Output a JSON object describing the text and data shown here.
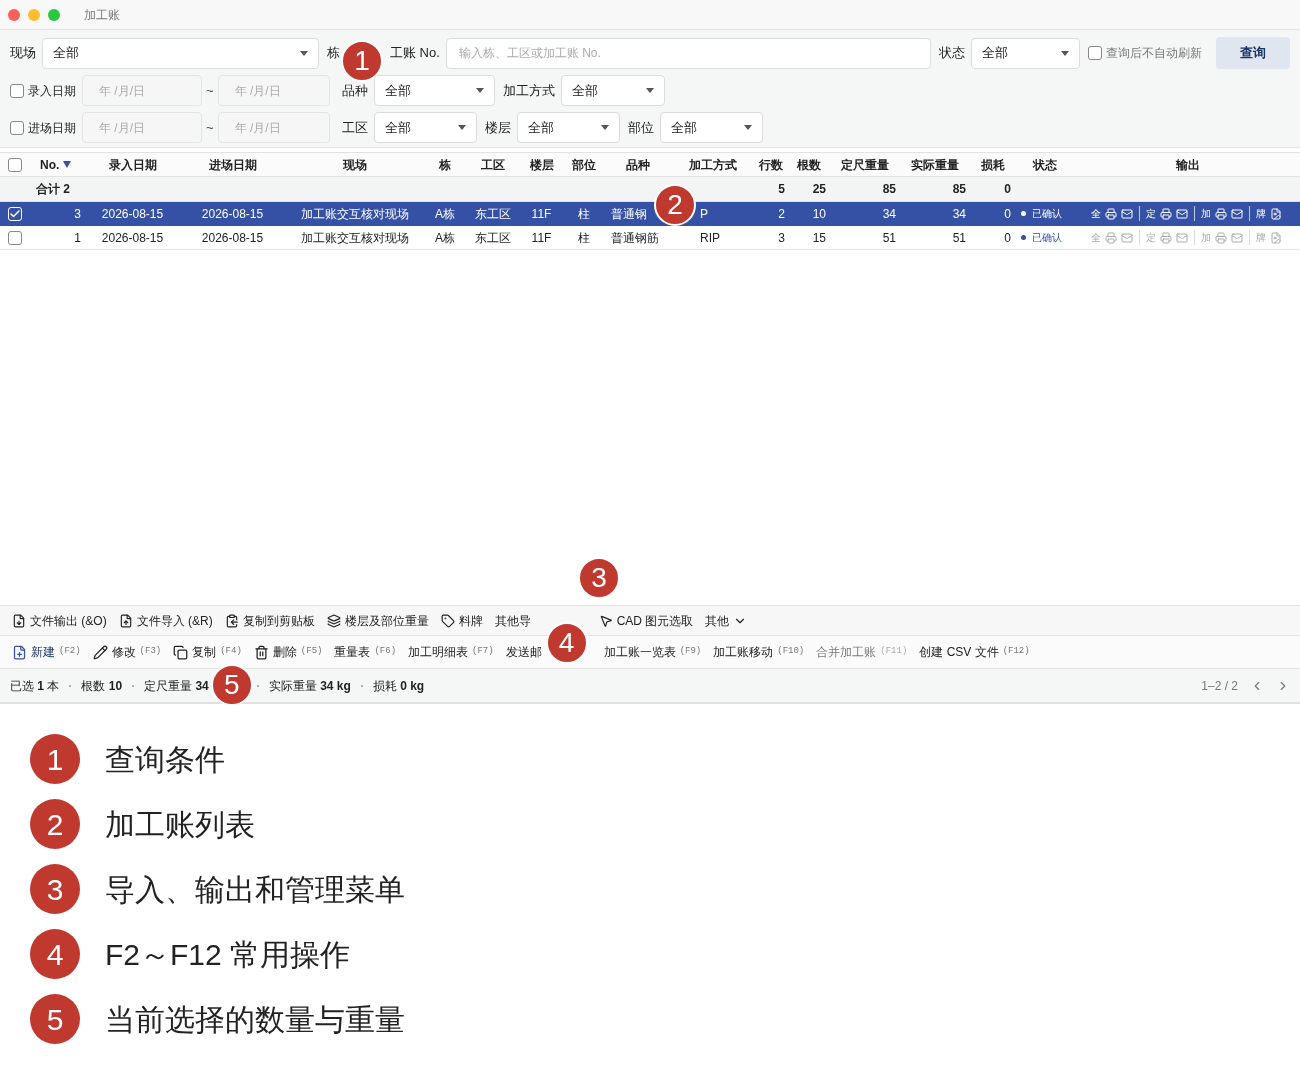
{
  "window": {
    "title": "加工账"
  },
  "filters": [
    [
      {
        "kind": "select",
        "label": "现场",
        "value": "全部"
      },
      {
        "kind": "text",
        "labels": [
          "栋",
          "工账 No."
        ],
        "placeholder": "输入栋、工区或加工账 No."
      },
      {
        "kind": "select",
        "label": "状态",
        "value": "全部"
      },
      {
        "kind": "checkbox",
        "label": "查询后不自动刷新",
        "checked": false
      },
      {
        "kind": "button",
        "label": "查询"
      }
    ],
    [
      {
        "kind": "date_range",
        "label": "录入日期",
        "checked": false,
        "from_placeholder": "年 /月/日",
        "separator": "~",
        "to_placeholder": "年 /月/日"
      },
      {
        "kind": "select",
        "label": "品种",
        "value": "全部"
      },
      {
        "kind": "select",
        "label": "加工方式",
        "value": "全部"
      }
    ],
    [
      {
        "kind": "date_range",
        "label": "进场日期",
        "checked": false,
        "from_placeholder": "年 /月/日",
        "separator": "~",
        "to_placeholder": "年 /月/日"
      },
      {
        "kind": "select",
        "label": "工区",
        "value": "全部"
      },
      {
        "kind": "select",
        "label": "楼层",
        "value": "全部"
      },
      {
        "kind": "select",
        "label": "部位",
        "value": "全部"
      }
    ]
  ],
  "table": {
    "all_checked": false,
    "columns": [
      {
        "label": "No.",
        "sorted": true
      },
      {
        "label": "录入日期",
        "sorted": false
      },
      {
        "label": "进场日期",
        "sorted": false
      },
      {
        "label": "现场",
        "sorted": false
      },
      {
        "label": "栋",
        "sorted": false
      },
      {
        "label": "工区",
        "sorted": false
      },
      {
        "label": "楼层",
        "sorted": false
      },
      {
        "label": "部位",
        "sorted": false
      },
      {
        "label": "品种",
        "sorted": false
      },
      {
        "label": "加工方式",
        "sorted": false
      },
      {
        "label": "行数",
        "sorted": false
      },
      {
        "label": "根数",
        "sorted": false
      },
      {
        "label": "定尺重量",
        "sorted": false
      },
      {
        "label": "实际重量",
        "sorted": false
      },
      {
        "label": "损耗",
        "sorted": false
      },
      {
        "label": "状态",
        "sorted": false
      },
      {
        "label": "输出",
        "sorted": false
      }
    ],
    "total": {
      "label": "合计 2",
      "values": [
        "5",
        "25",
        "85",
        "85",
        "0"
      ]
    },
    "rows": [
      {
        "selected": true,
        "cells": [
          "3",
          "2026-08-15",
          "2026-08-15",
          "加工账交互核对现场",
          "A栋",
          "东工区",
          "11F",
          "柱",
          "普通钢",
          "P",
          "2",
          "10",
          "34",
          "34",
          "0"
        ],
        "status": "已确认",
        "outputs": [
          "全",
          "定",
          "加",
          "牌"
        ]
      },
      {
        "selected": false,
        "cells": [
          "1",
          "2026-08-15",
          "2026-08-15",
          "加工账交互核对现场",
          "A栋",
          "东工区",
          "11F",
          "柱",
          "普通钢筋",
          "RIP",
          "3",
          "15",
          "51",
          "51",
          "0"
        ],
        "status": "已确认",
        "outputs": [
          "全",
          "定",
          "加",
          "牌"
        ]
      }
    ]
  },
  "menu_bar": [
    {
      "kind": "action",
      "label": "文件输出 (&O)"
    },
    {
      "kind": "action",
      "label": "文件导入 (&R)"
    },
    {
      "kind": "action",
      "label": "复制到剪贴板"
    },
    {
      "kind": "action",
      "label": "楼层及部位重量"
    },
    {
      "kind": "action",
      "label": "料牌"
    },
    {
      "kind": "action",
      "label": "其他导"
    },
    {
      "kind": "action",
      "label": "CAD 图元选取"
    },
    {
      "kind": "menu",
      "label": "其他"
    }
  ],
  "actions": [
    {
      "label": "新建",
      "shortcut": "(F2)",
      "primary": true,
      "disabled": false
    },
    {
      "label": "修改",
      "shortcut": "(F3)",
      "primary": false,
      "disabled": false
    },
    {
      "label": "复制",
      "shortcut": "(F4)",
      "primary": false,
      "disabled": false
    },
    {
      "label": "删除",
      "shortcut": "(F5)",
      "primary": false,
      "disabled": false
    },
    {
      "label": "重量表",
      "shortcut": "(F6)",
      "primary": false,
      "disabled": false
    },
    {
      "label": "加工明细表",
      "shortcut": "(F7)",
      "primary": false,
      "disabled": false
    },
    {
      "label": "发送邮",
      "primary": false,
      "disabled": false
    },
    {
      "label": "加工账一览表",
      "shortcut": "(F9)",
      "primary": false,
      "disabled": false
    },
    {
      "label": "加工账移动",
      "shortcut": "(F10)",
      "primary": false,
      "disabled": false
    },
    {
      "label": "合并加工账",
      "shortcut": "(F11)",
      "primary": false,
      "disabled": true
    },
    {
      "label": "创建 CSV 文件",
      "shortcut": "(F12)",
      "primary": false,
      "disabled": false
    }
  ],
  "status_bar": {
    "items": [
      "已选 **1** 本",
      "根数 **10**",
      "定尺重量 **34**",
      "实际重量 **34 kg**",
      "损耗 **0 kg**"
    ],
    "pagination": "1–2 / 2"
  },
  "callouts": [
    "1",
    "2",
    "3",
    "4",
    "5"
  ],
  "legend": [
    {
      "number": "1",
      "text": "查询条件"
    },
    {
      "number": "2",
      "text": "加工账列表"
    },
    {
      "number": "3",
      "text": "导入、输出和管理菜单"
    },
    {
      "number": "4",
      "text": "F2～F12 常用操作"
    },
    {
      "number": "5",
      "text": "当前选择的数量与重量"
    }
  ]
}
